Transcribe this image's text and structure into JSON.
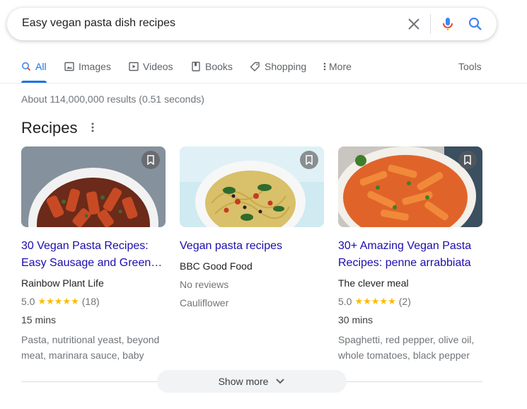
{
  "search": {
    "query": "Easy vegan pasta dish recipes"
  },
  "tabs": [
    {
      "label": "All",
      "icon": "search-icon"
    },
    {
      "label": "Images",
      "icon": "image-icon"
    },
    {
      "label": "Videos",
      "icon": "video-icon"
    },
    {
      "label": "Books",
      "icon": "book-icon"
    },
    {
      "label": "Shopping",
      "icon": "tag-icon"
    },
    {
      "label": "More",
      "icon": "more-vert-icon"
    }
  ],
  "tools_label": "Tools",
  "result_stats": "About 114,000,000 results (0.51 seconds)",
  "section_title": "Recipes",
  "cards": [
    {
      "title": "30 Vegan Pasta Recipes: Easy Sausage and Green…",
      "source": "Rainbow Plant Life",
      "rating": "5.0",
      "stars": "★★★★★",
      "count": "(18)",
      "time": "15 mins",
      "ingredients": "Pasta, nutritional yeast, beyond meat, marinara sauce, baby"
    },
    {
      "title": "Vegan pasta recipes",
      "source": "BBC Good Food",
      "reviews": "No reviews",
      "ingredients": "Cauliflower"
    },
    {
      "title": "30+ Amazing Vegan Pasta Recipes: penne arrabbiata",
      "source": "The clever meal",
      "rating": "5.0",
      "stars": "★★★★★",
      "count": "(2)",
      "time": "30 mins",
      "ingredients": "Spaghetti, red pepper, olive oil, whole tomatoes, black pepper"
    }
  ],
  "show_more_label": "Show more",
  "colors": {
    "link": "#1a0dab",
    "accent": "#1a73e8",
    "star": "#fbbc04"
  }
}
